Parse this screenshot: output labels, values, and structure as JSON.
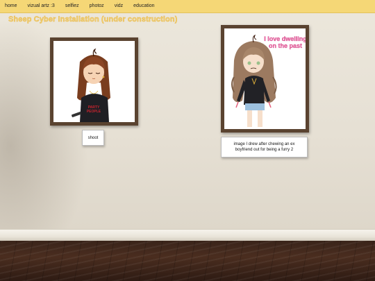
{
  "nav": {
    "items": [
      {
        "label": "home"
      },
      {
        "label": "vizual artz :3"
      },
      {
        "label": "selfiez"
      },
      {
        "label": "photoz"
      },
      {
        "label": "vidz"
      },
      {
        "label": "education"
      }
    ]
  },
  "site_title": "Sheep Cyber Installation (under construction)",
  "gallery": {
    "artwork1": {
      "caption": "shoot",
      "shirt_text": "PARTY PEOPLE"
    },
    "artwork2": {
      "overlay_text": "I love dwelling on the past",
      "caption": "image I drew after chewing an ex boyfriend out for being a furry 2"
    }
  },
  "colors": {
    "nav_bg": "#f5d776",
    "title": "#f3d173",
    "frame": "#5a4330",
    "floor": "#3a241a",
    "overlay_pink": "#f06aa8"
  }
}
